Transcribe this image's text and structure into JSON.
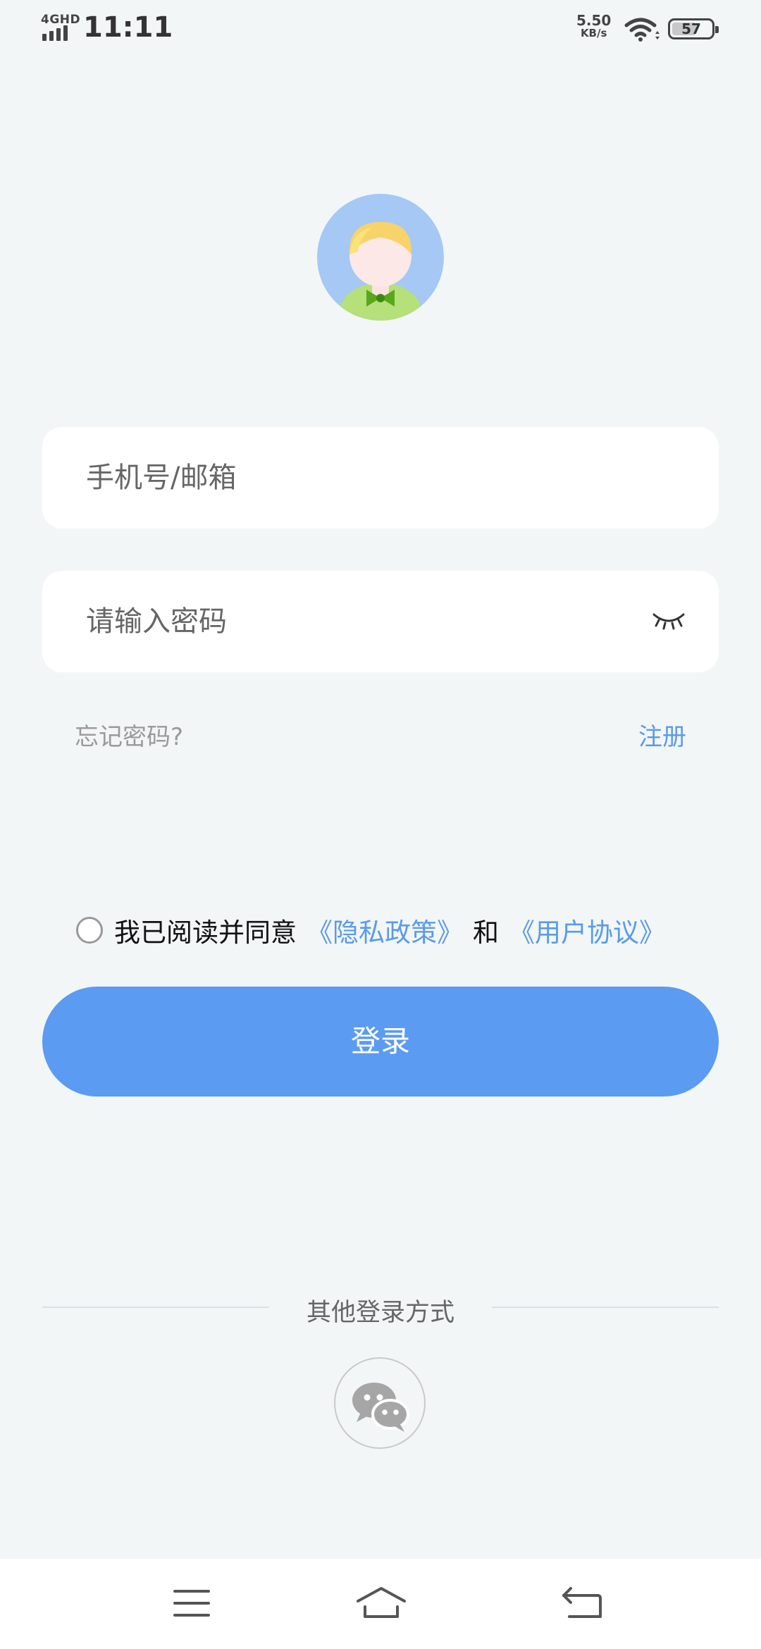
{
  "status_bar": {
    "network": "4GHD",
    "time": "11:11",
    "speed_value": "5.50",
    "speed_unit": "KB/s",
    "battery": "57"
  },
  "login": {
    "account_placeholder": "手机号/邮箱",
    "password_placeholder": "请输入密码",
    "forgot_password": "忘记密码?",
    "register": "注册",
    "agree_prefix": "我已阅读并同意",
    "privacy_policy": "《隐私政策》",
    "agree_and": "和",
    "user_agreement": "《用户协议》",
    "login_button": "登录",
    "other_login": "其他登录方式"
  },
  "icons": {
    "avatar": "avatar",
    "password_toggle": "eye-closed-icon",
    "wechat": "wechat-icon",
    "nav_menu": "menu-icon",
    "nav_home": "home-icon",
    "nav_back": "back-icon"
  },
  "colors": {
    "background": "#f2f6f7",
    "accent": "#5b9bf2",
    "link": "#5b9be8"
  }
}
